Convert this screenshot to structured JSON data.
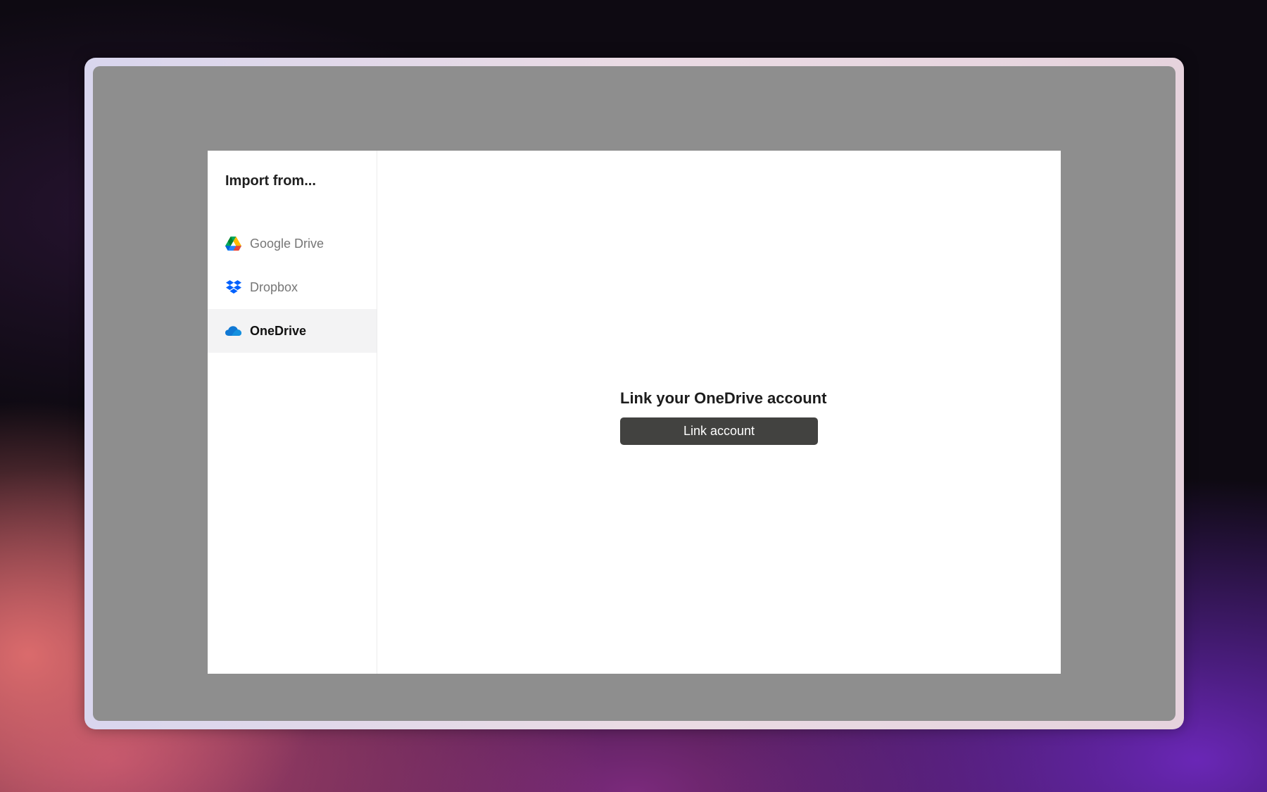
{
  "modal": {
    "sidebar": {
      "title": "Import from...",
      "items": [
        {
          "label": "Google Drive",
          "icon": "google-drive-icon",
          "active": false
        },
        {
          "label": "Dropbox",
          "icon": "dropbox-icon",
          "active": false
        },
        {
          "label": "OneDrive",
          "icon": "onedrive-icon",
          "active": true
        }
      ]
    },
    "main": {
      "heading": "Link your OneDrive account",
      "button_label": "Link account"
    }
  },
  "colors": {
    "overlay": "#8e8e8e",
    "button": "#424240",
    "active_item_bg": "#f3f3f4",
    "onedrive_blue": "#0f78d4"
  }
}
